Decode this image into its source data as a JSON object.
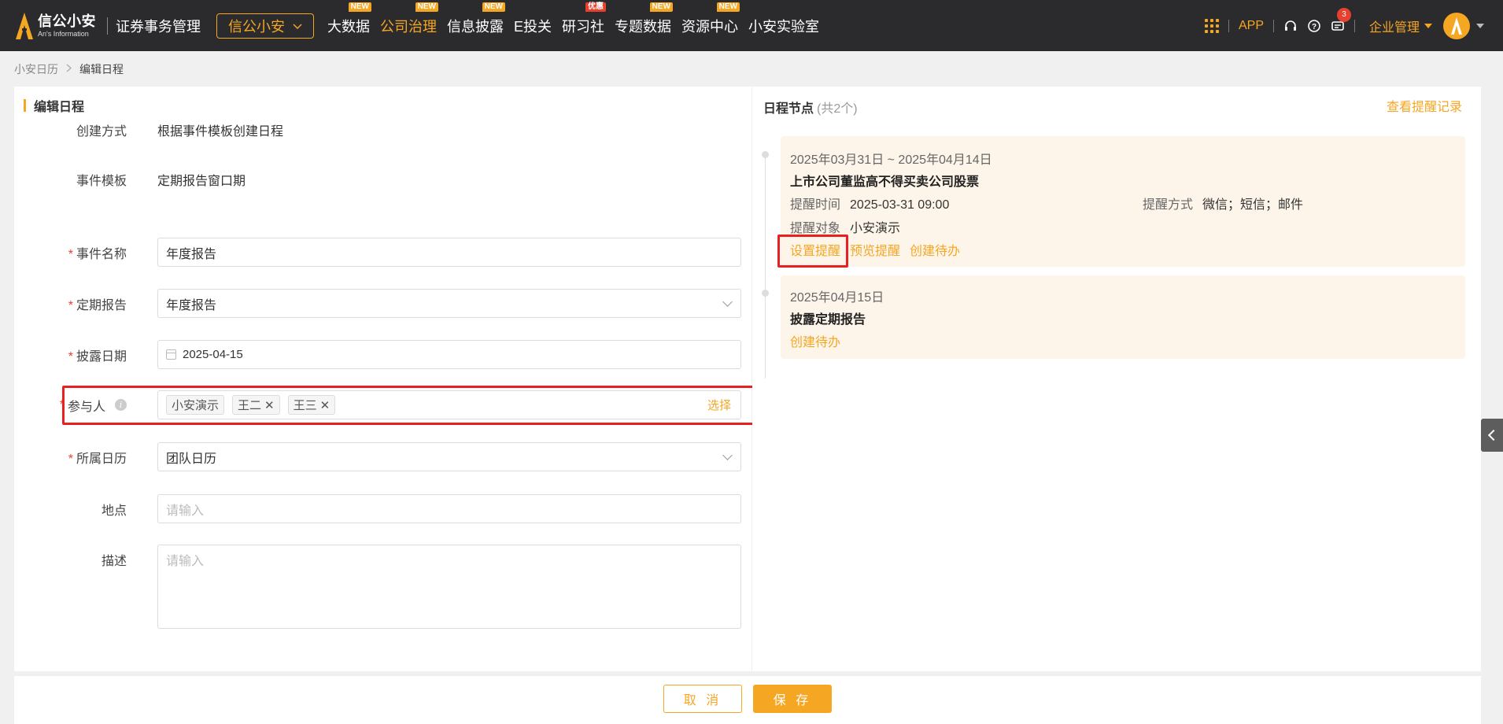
{
  "app": {
    "logo_cn": "信公小安",
    "logo_en": "An's Information",
    "product": "证券事务管理",
    "org_select": "信公小安"
  },
  "nav": [
    {
      "label": "大数据",
      "badge": "NEW",
      "badge_color": "#f5a623"
    },
    {
      "label": "公司治理",
      "badge": "NEW",
      "badge_color": "#f5a623",
      "active": true
    },
    {
      "label": "信息披露",
      "badge": "NEW",
      "badge_color": "#f5a623"
    },
    {
      "label": "E投关",
      "badge": ""
    },
    {
      "label": "研习社",
      "badge": "优惠",
      "badge_color": "#e8402e"
    },
    {
      "label": "专题数据",
      "badge": "NEW",
      "badge_color": "#f5a623"
    },
    {
      "label": "资源中心",
      "badge": "NEW",
      "badge_color": "#f5a623"
    },
    {
      "label": "小安实验室",
      "badge": ""
    }
  ],
  "topright": {
    "app_label": "APP",
    "notification_count": "3",
    "enterprise_label": "企业管理"
  },
  "breadcrumb": {
    "parent": "小安日历",
    "current": "编辑日程"
  },
  "form": {
    "title": "编辑日程",
    "create_method_label": "创建方式",
    "create_method_value": "根据事件模板创建日程",
    "template_label": "事件模板",
    "template_value": "定期报告窗口期",
    "event_name_label": "事件名称",
    "event_name_value": "年度报告",
    "periodic_label": "定期报告",
    "periodic_value": "年度报告",
    "disclose_label": "披露日期",
    "disclose_value": "2025-04-15",
    "participants_label": "参与人",
    "participants": [
      {
        "name": "小安演示",
        "removable": false
      },
      {
        "name": "王二",
        "removable": true
      },
      {
        "name": "王三",
        "removable": true
      }
    ],
    "choose_label": "选择",
    "calendar_label": "所属日历",
    "calendar_value": "团队日历",
    "location_label": "地点",
    "location_placeholder": "请输入",
    "desc_label": "描述",
    "desc_placeholder": "请输入",
    "required_mark": "*"
  },
  "schedule": {
    "title": "日程节点",
    "count": "(共2个)",
    "history_link": "查看提醒记录",
    "nodes": [
      {
        "date": "2025年03月31日 ~ 2025年04月14日",
        "title": "上市公司董监高不得买卖公司股票",
        "remind_time_label": "提醒时间",
        "remind_time_value": "2025-03-31 09:00",
        "remind_way_label": "提醒方式",
        "remind_way_value": "微信；短信；邮件",
        "remind_target_label": "提醒对象",
        "remind_target_value": "小安演示",
        "actions": [
          "设置提醒",
          "预览提醒",
          "创建待办"
        ]
      },
      {
        "date": "2025年04月15日",
        "title": "披露定期报告",
        "actions": [
          "创建待办"
        ]
      }
    ]
  },
  "footer": {
    "cancel_label": "取 消",
    "save_label": "保 存"
  },
  "colors": {
    "accent": "#f5a623",
    "topbar": "#2b2b2d",
    "highlight": "#e82020"
  },
  "icons": [
    "apps-grid-icon",
    "headset-icon",
    "help-icon",
    "message-icon",
    "calendar-icon",
    "info-icon",
    "close-icon",
    "chevron-down-icon",
    "chevron-left-icon"
  ]
}
